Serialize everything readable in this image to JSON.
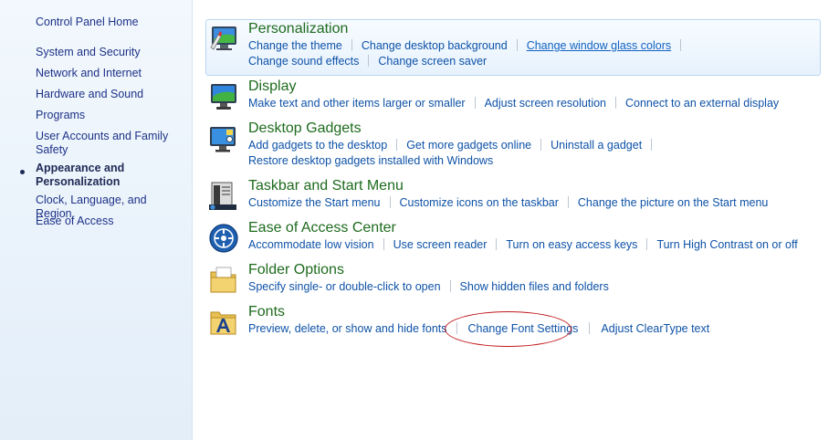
{
  "sidebar": {
    "home": "Control Panel Home",
    "items": [
      {
        "label": "System and Security"
      },
      {
        "label": "Network and Internet"
      },
      {
        "label": "Hardware and Sound"
      },
      {
        "label": "Programs"
      },
      {
        "label": "User Accounts and Family Safety"
      },
      {
        "label": "Appearance and Personalization",
        "current": true
      },
      {
        "label": "Clock, Language, and Region"
      },
      {
        "label": "Ease of Access"
      }
    ]
  },
  "categories": [
    {
      "title": "Personalization",
      "icon": "personalization-icon",
      "highlighted": true,
      "lines": [
        [
          "Change the theme",
          "Change desktop background",
          "Change window glass colors"
        ],
        [
          "Change sound effects",
          "Change screen saver"
        ]
      ]
    },
    {
      "title": "Display",
      "icon": "display-icon",
      "lines": [
        [
          "Make text and other items larger or smaller",
          "Adjust screen resolution",
          "Connect to an external display"
        ]
      ]
    },
    {
      "title": "Desktop Gadgets",
      "icon": "desktop-gadgets-icon",
      "lines": [
        [
          "Add gadgets to the desktop",
          "Get more gadgets online",
          "Uninstall a gadget"
        ],
        [
          "Restore desktop gadgets installed with Windows"
        ]
      ]
    },
    {
      "title": "Taskbar and Start Menu",
      "icon": "taskbar-icon",
      "lines": [
        [
          "Customize the Start menu",
          "Customize icons on the taskbar",
          "Change the picture on the Start menu"
        ]
      ]
    },
    {
      "title": "Ease of Access Center",
      "icon": "ease-of-access-icon",
      "lines": [
        [
          "Accommodate low vision",
          "Use screen reader",
          "Turn on easy access keys",
          "Turn High Contrast on or off"
        ]
      ]
    },
    {
      "title": "Folder Options",
      "icon": "folder-options-icon",
      "lines": [
        [
          "Specify single- or double-click to open",
          "Show hidden files and folders"
        ]
      ]
    },
    {
      "title": "Fonts",
      "icon": "fonts-icon",
      "lines": [
        [
          "Preview, delete, or show and hide fonts",
          "Change Font Settings",
          "Adjust ClearType text"
        ]
      ]
    }
  ],
  "hovered_link": "Change window glass colors",
  "circled_link": "Change Font Settings",
  "colors": {
    "link": "#0e52a7",
    "category_title": "#1e6b1e",
    "annotation": "#c0181c"
  }
}
